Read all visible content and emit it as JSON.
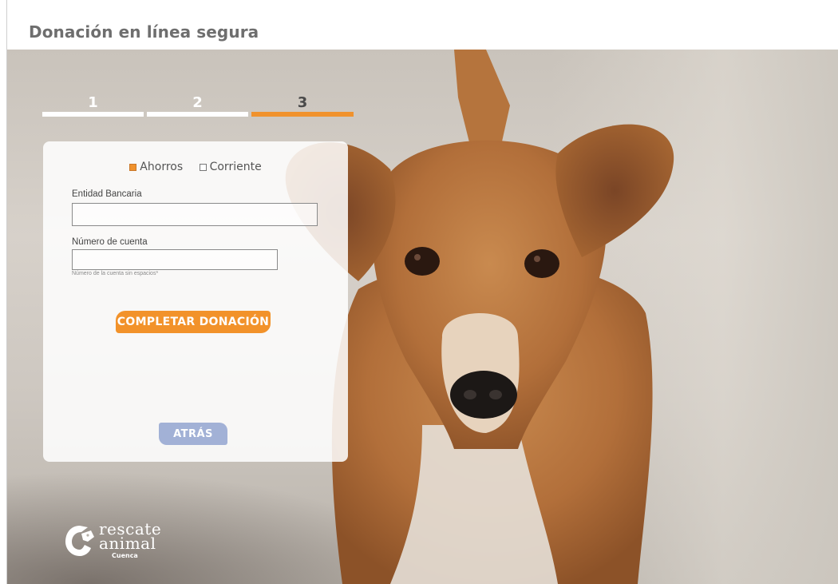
{
  "page": {
    "title": "Donación en línea segura"
  },
  "steps": [
    {
      "label": "1",
      "active": false
    },
    {
      "label": "2",
      "active": false
    },
    {
      "label": "3",
      "active": true
    }
  ],
  "form": {
    "account_types": [
      {
        "label": "Ahorros",
        "checked": true
      },
      {
        "label": "Corriente",
        "checked": false
      }
    ],
    "bank_label": "Entidad Bancaria",
    "bank_value": "",
    "account_label": "Número de cuenta",
    "account_value": "",
    "account_hint": "Número de la cuenta sin espacios*",
    "complete_button": "COMPLETAR DONACIÓN",
    "back_button": "ATRÁS"
  },
  "logo": {
    "line1": "rescate",
    "line2": "animal",
    "city": "Cuenca"
  },
  "colors": {
    "accent": "#f2922a",
    "back_button": "#a2b1d6",
    "title_text": "#6e6e6e"
  },
  "icons": {
    "logo_mark": "dog-head-logo-icon",
    "hero_image": "puppy-photo"
  }
}
